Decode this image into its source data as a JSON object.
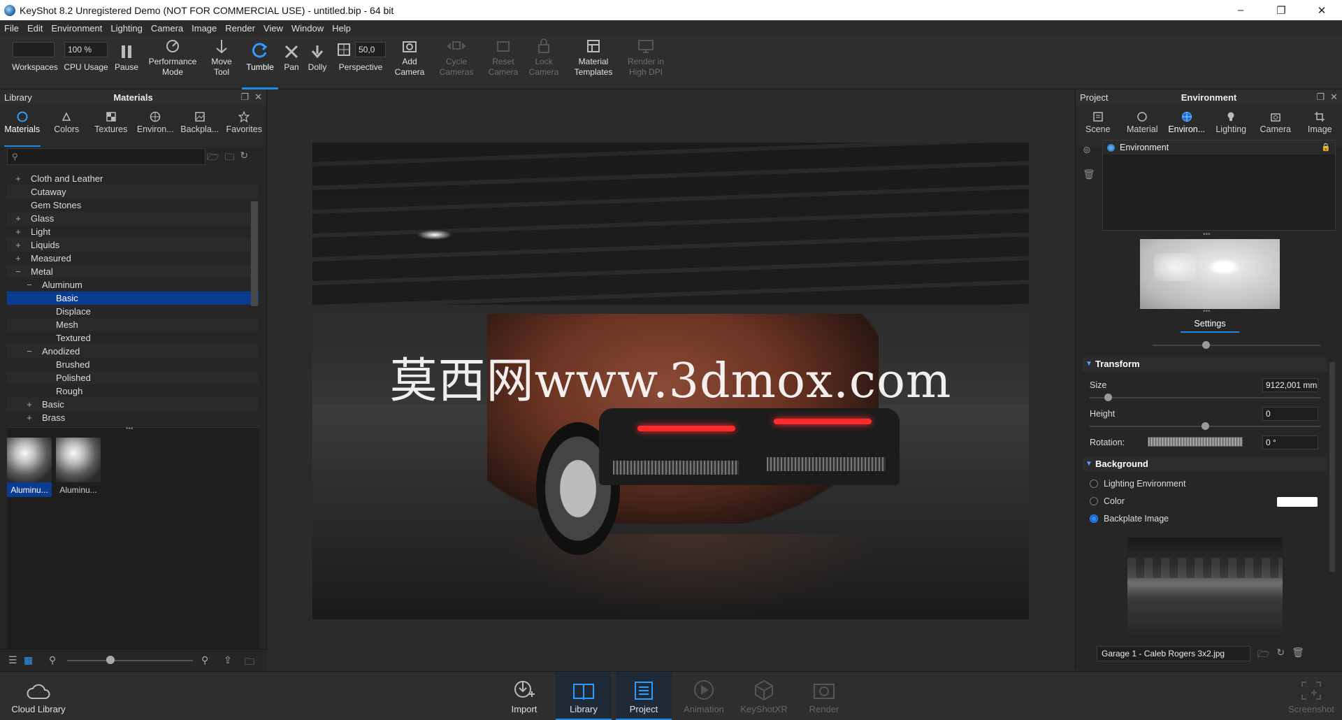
{
  "window": {
    "title": "KeyShot 8.2 Unregistered Demo (NOT FOR COMMERCIAL USE) - untitled.bip  - 64 bit",
    "controls": [
      "–",
      "❐",
      "✕"
    ]
  },
  "menu": [
    "File",
    "Edit",
    "Environment",
    "Lighting",
    "Camera",
    "Image",
    "Render",
    "View",
    "Window",
    "Help"
  ],
  "toolbar": {
    "zoom_value": "100 %",
    "fov_value": "50,0",
    "items": {
      "workspaces": "Workspaces",
      "cpu_usage": "CPU Usage",
      "pause": "Pause",
      "performance_mode": "Performance\nMode",
      "move_tool": "Move\nTool",
      "tumble": "Tumble",
      "pan": "Pan",
      "dolly": "Dolly",
      "perspective": "Perspective",
      "add_camera": "Add\nCamera",
      "cycle_cameras": "Cycle\nCameras",
      "reset_camera": "Reset\nCamera",
      "lock_camera": "Lock\nCamera",
      "material_templates": "Material\nTemplates",
      "render_high_dpi": "Render in\nHigh DPI"
    }
  },
  "library": {
    "header_left": "Library",
    "header_title": "Materials",
    "tabs": [
      "Materials",
      "Colors",
      "Textures",
      "Environ...",
      "Backpla...",
      "Favorites"
    ],
    "active_tab": "Materials",
    "search_placeholder": "",
    "tree": [
      {
        "label": "Cloth and Leather",
        "level": 0,
        "expander": "+"
      },
      {
        "label": "Cutaway",
        "level": 0,
        "expander": ""
      },
      {
        "label": "Gem Stones",
        "level": 0,
        "expander": ""
      },
      {
        "label": "Glass",
        "level": 0,
        "expander": "+"
      },
      {
        "label": "Light",
        "level": 0,
        "expander": "+"
      },
      {
        "label": "Liquids",
        "level": 0,
        "expander": "+"
      },
      {
        "label": "Measured",
        "level": 0,
        "expander": "+"
      },
      {
        "label": "Metal",
        "level": 0,
        "expander": "−"
      },
      {
        "label": "Aluminum",
        "level": 1,
        "expander": "−"
      },
      {
        "label": "Basic",
        "level": 2,
        "expander": "",
        "selected": true
      },
      {
        "label": "Displace",
        "level": 2,
        "expander": ""
      },
      {
        "label": "Mesh",
        "level": 2,
        "expander": ""
      },
      {
        "label": "Textured",
        "level": 2,
        "expander": ""
      },
      {
        "label": "Anodized",
        "level": 1,
        "expander": "−"
      },
      {
        "label": "Brushed",
        "level": 2,
        "expander": ""
      },
      {
        "label": "Polished",
        "level": 2,
        "expander": ""
      },
      {
        "label": "Rough",
        "level": 2,
        "expander": ""
      },
      {
        "label": "Basic",
        "level": 1,
        "expander": "+"
      },
      {
        "label": "Brass",
        "level": 1,
        "expander": "+"
      }
    ],
    "thumbnails": [
      {
        "label": "Aluminu...",
        "selected": true
      },
      {
        "label": "Aluminu...",
        "selected": false
      }
    ]
  },
  "viewport": {
    "watermark": "莫西网www.3dmox.com"
  },
  "project": {
    "header_left": "Project",
    "header_title": "Environment",
    "tabs": [
      "Scene",
      "Material",
      "Environ...",
      "Lighting",
      "Camera",
      "Image"
    ],
    "active_tab": "Environ...",
    "env_list": [
      "Environment"
    ],
    "settings_tab": "Settings",
    "transform": {
      "title": "Transform",
      "size_label": "Size",
      "size_value": "9122,001 mm",
      "size_level": 0.08,
      "height_label": "Height",
      "height_value": "0",
      "height_level": 0.5,
      "rotation_label": "Rotation:",
      "rotation_value": "0 °"
    },
    "background": {
      "title": "Background",
      "options": [
        "Lighting Environment",
        "Color",
        "Backplate Image"
      ],
      "selected": "Backplate Image",
      "color_swatch": "#ffffff",
      "backplate_file": "Garage 1 -  Caleb Rogers 3x2.jpg"
    }
  },
  "bottombar": {
    "cloud_library": "Cloud Library",
    "import": "Import",
    "library": "Library",
    "project": "Project",
    "animation": "Animation",
    "keyshotxr": "KeyShotXR",
    "render": "Render",
    "screenshot": "Screenshot"
  },
  "colors": {
    "accent": "#1e88e5",
    "selection": "#0a3d91",
    "tail_lights": "#ff2a2a"
  }
}
